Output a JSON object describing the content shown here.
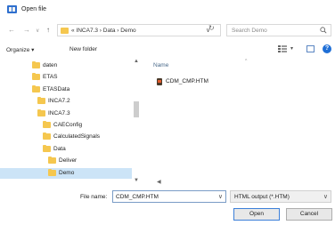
{
  "window": {
    "title": "Open file",
    "icon": "app-icon"
  },
  "nav": {
    "back_icon": "back-arrow-icon",
    "forward_icon": "forward-arrow-icon",
    "recent_icon": "chevron-down-icon",
    "up_icon": "up-arrow-icon",
    "address_prefix": "«",
    "address_path": [
      "INCA7.3",
      "Data",
      "Demo"
    ],
    "address_text": "« INCA7.3 › Data › Demo",
    "refresh_icon": "refresh-icon",
    "search_placeholder": "Search Demo"
  },
  "toolbar": {
    "organize_label": "Organize ▾",
    "new_folder_label": "New folder"
  },
  "tree": [
    {
      "label": "daten",
      "depth": 0
    },
    {
      "label": "ETAS",
      "depth": 0
    },
    {
      "label": "ETASData",
      "depth": 0
    },
    {
      "label": "INCA7.2",
      "depth": 1
    },
    {
      "label": "INCA7.3",
      "depth": 1
    },
    {
      "label": "CAEConfig",
      "depth": 2
    },
    {
      "label": "CalculatedSignals",
      "depth": 2
    },
    {
      "label": "Data",
      "depth": 2
    },
    {
      "label": "Deliver",
      "depth": 3
    },
    {
      "label": "Demo",
      "depth": 3,
      "selected": true
    }
  ],
  "content": {
    "column_name": "Name",
    "files": [
      {
        "name": "CDM_CMP.HTM",
        "icon": "html-file-icon"
      }
    ]
  },
  "bottom": {
    "file_name_label": "File name:",
    "file_name_value": "CDM_CMP.HTM",
    "file_type_value": "HTML output (*.HTM)",
    "open_label": "Open",
    "cancel_label": "Cancel"
  },
  "colors": {
    "selected": "#cce4f7",
    "folder": "#f5c74f",
    "accent": "#1f6fd6"
  }
}
